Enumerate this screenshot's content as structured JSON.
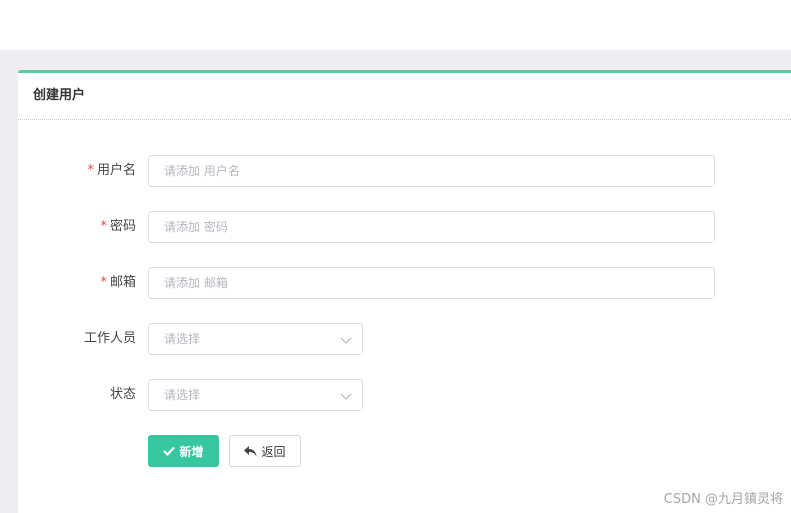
{
  "card": {
    "title": "创建用户"
  },
  "form": {
    "username": {
      "label": "用户名",
      "required_mark": "*",
      "placeholder": "请添加 用户名",
      "value": ""
    },
    "password": {
      "label": "密码",
      "required_mark": "*",
      "placeholder": "请添加 密码",
      "value": ""
    },
    "email": {
      "label": "邮箱",
      "required_mark": "*",
      "placeholder": "请添加 邮箱",
      "value": ""
    },
    "staff": {
      "label": "工作人员",
      "placeholder": "请选择"
    },
    "status": {
      "label": "状态",
      "placeholder": "请选择"
    }
  },
  "buttons": {
    "add_label": "新增",
    "add_icon": "check-icon",
    "back_label": "返回",
    "back_icon": "reply-arrow-icon"
  },
  "watermark": "CSDN @九月镇灵将",
  "colors": {
    "accent": "#36c6a0",
    "card_border": "#5ccba0",
    "required": "#e84c3d",
    "page_bg": "#edeef2"
  }
}
